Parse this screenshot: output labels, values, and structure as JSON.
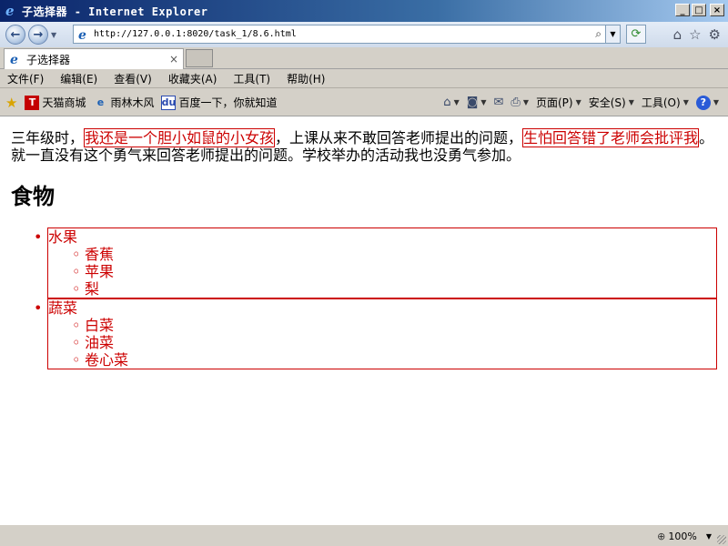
{
  "window": {
    "title": "子选择器 - Internet Explorer",
    "controls": {
      "minimize": "_",
      "maximize": "□",
      "close": "×"
    }
  },
  "address_bar": {
    "url": "http://127.0.0.1:8020/task_1/8.6.html"
  },
  "tab": {
    "label": "子选择器",
    "close": "×"
  },
  "menu": [
    "文件(F)",
    "编辑(E)",
    "查看(V)",
    "收藏夹(A)",
    "工具(T)",
    "帮助(H)"
  ],
  "favorites": [
    {
      "label": "天猫商城",
      "icon": "tmall-icon",
      "glyph": "T"
    },
    {
      "label": "雨林木风",
      "icon": "ie-page-icon",
      "glyph": "e"
    },
    {
      "label": "百度一下，你就知道",
      "icon": "baidu-icon",
      "glyph": "du"
    }
  ],
  "command_bar": {
    "page": "页面(P)",
    "safety": "安全(S)",
    "tools": "工具(O)",
    "help_glyph": "?"
  },
  "content": {
    "para_part1": "三年级时，",
    "para_hl1": "我还是一个胆小如鼠的小女孩",
    "para_part2": "，上课从来不敢回答老师提出的问题，",
    "para_hl2": "生怕回答错了老师会批评我",
    "para_part3": "。就一直没有这个勇气来回答老师提出的问题。学校举办的活动我也没勇气参加。",
    "heading": "食物",
    "groups": [
      {
        "label": "水果",
        "items": [
          "香蕉",
          "苹果",
          "梨"
        ]
      },
      {
        "label": "蔬菜",
        "items": [
          "白菜",
          "油菜",
          "卷心菜"
        ]
      }
    ]
  },
  "status": {
    "zoom": "100%"
  },
  "colors": {
    "highlight": "#cc0000",
    "title_bar": "#0a246a"
  }
}
